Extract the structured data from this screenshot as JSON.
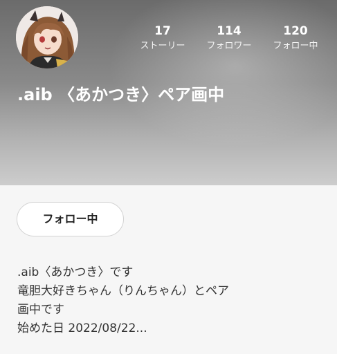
{
  "profile": {
    "name": ".aib 〈あかつき〉ペア画中",
    "avatar_icon": "anime-character-avatar"
  },
  "stats": [
    {
      "value": "17",
      "label": "ストーリー"
    },
    {
      "value": "114",
      "label": "フォロワー"
    },
    {
      "value": "120",
      "label": "フォロー中"
    }
  ],
  "actions": {
    "follow_label": "フォロー中"
  },
  "bio": {
    "lines": [
      ".aib〈あかつき〉です",
      "竜胆大好きちゃん（りんちゃん）とペア",
      "画中です",
      "始めた日  2022/08/22..."
    ]
  },
  "colors": {
    "header_dark": "#6b6b6b",
    "header_light": "#cdcdcd",
    "background": "#f6f6f6",
    "text": "#333333"
  }
}
